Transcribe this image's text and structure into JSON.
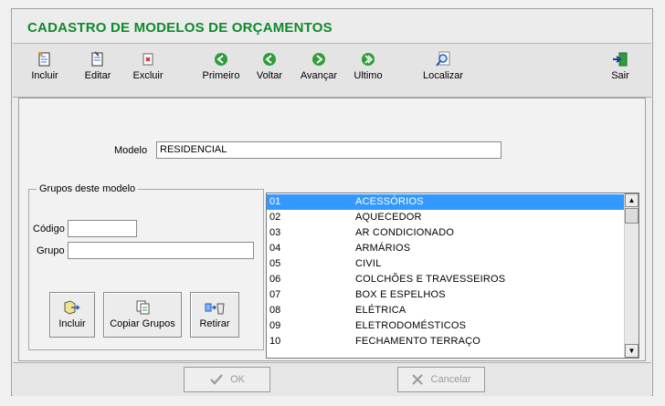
{
  "window": {
    "title": "CADASTRO DE MODELOS DE ORÇAMENTOS"
  },
  "toolbar": {
    "incluir": "Incluir",
    "editar": "Editar",
    "excluir": "Excluir",
    "primeiro": "Primeiro",
    "voltar": "Voltar",
    "avancar": "Avançar",
    "ultimo": "Ultimo",
    "localizar": "Localizar",
    "sair": "Sair"
  },
  "form": {
    "modelo_label": "Modelo",
    "modelo_value": "RESIDENCIAL",
    "grupos_legend": "Grupos deste modelo",
    "codigo_label": "Código",
    "codigo_value": "",
    "grupo_label": "Grupo",
    "grupo_value": ""
  },
  "group_buttons": {
    "incluir": "Incluir",
    "copiar": "Copiar Grupos",
    "retirar": "Retirar"
  },
  "groups_list": [
    {
      "code": "01",
      "name": "ACESSÓRIOS",
      "selected": true
    },
    {
      "code": "02",
      "name": "AQUECEDOR"
    },
    {
      "code": "03",
      "name": "AR CONDICIONADO"
    },
    {
      "code": "04",
      "name": "ARMÁRIOS"
    },
    {
      "code": "05",
      "name": "CIVIL"
    },
    {
      "code": "06",
      "name": "COLCHÕES E TRAVESSEIROS"
    },
    {
      "code": "07",
      "name": "BOX E ESPELHOS"
    },
    {
      "code": "08",
      "name": "ELÉTRICA"
    },
    {
      "code": "09",
      "name": "ELETRODOMÉSTICOS"
    },
    {
      "code": "10",
      "name": "FECHAMENTO TERRAÇO"
    }
  ],
  "footer": {
    "ok": "OK",
    "cancelar": "Cancelar"
  },
  "colors": {
    "title": "#0f8a2c",
    "selection": "#3399ff",
    "nav_green": "#2e9e3a"
  }
}
